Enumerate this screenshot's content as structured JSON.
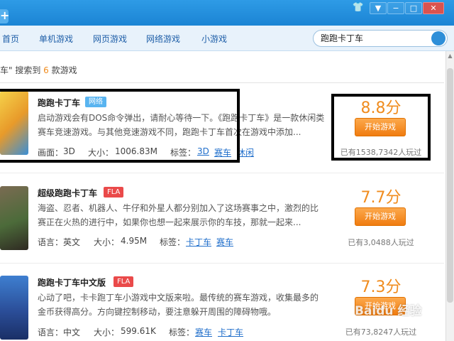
{
  "window": {
    "controls": [
      "▼",
      "−",
      "□",
      "✕"
    ]
  },
  "nav": {
    "items": [
      "首页",
      "单机游戏",
      "网页游戏",
      "网络游戏",
      "小游戏"
    ],
    "search_value": "跑跑卡丁车"
  },
  "results": {
    "prefix": "车\" 搜索到 ",
    "count": "6",
    "suffix": " 款游戏"
  },
  "games": [
    {
      "title": "跑跑卡丁车",
      "tag": "网络",
      "desc": "启动游戏会有DOS命令弹出，请耐心等待一下。《跑跑卡丁车》是一款休闲类赛车竞速游戏。与其他竞速游戏不同，跑跑卡丁车首次在游戏中添加...",
      "meta1_label": "画面：",
      "meta1_value": "3D",
      "size_label": "大小：",
      "size": "1006.83M",
      "tags_label": "标签：",
      "tags": [
        "3D",
        "赛车",
        "休闲"
      ],
      "score": "8.8分",
      "play_label": "开始游戏",
      "plays": "已有1538,7342人玩过"
    },
    {
      "title": "超级跑跑卡丁车",
      "tag": "FLA",
      "desc": "海盗、忍者、机器人、牛仔和外星人都分别加入了这场赛事之中，激烈的比赛正在火热的进行中，如果你也想一起来展示你的车技，那就一起来...",
      "meta1_label": "语言：",
      "meta1_value": "英文",
      "size_label": "大小：",
      "size": "4.95M",
      "tags_label": "标签：",
      "tags": [
        "卡丁车",
        "赛车"
      ],
      "score": "7.7分",
      "play_label": "开始游戏",
      "plays": "已有3,0488人玩过"
    },
    {
      "title": "跑跑卡丁车中文版",
      "tag": "FLA",
      "desc": "心动了吧，卡卡跑丁车小游戏中文版来啦。最传统的赛车游戏，收集最多的金币获得高分。方向键控制移动，要注意躲开周围的障碍物哦。",
      "meta1_label": "语言：",
      "meta1_value": "中文",
      "size_label": "大小：",
      "size": "599.61K",
      "tags_label": "标签：",
      "tags": [
        "赛车",
        "卡丁车"
      ],
      "score": "7.3分",
      "play_label": "开始游戏",
      "plays": "已有73,8247人玩过"
    }
  ],
  "watermark": "Baidu 经验",
  "colors": {
    "accent": "#f08c1e",
    "titlebar": "#1b84d4",
    "link": "#1f6ecb"
  }
}
